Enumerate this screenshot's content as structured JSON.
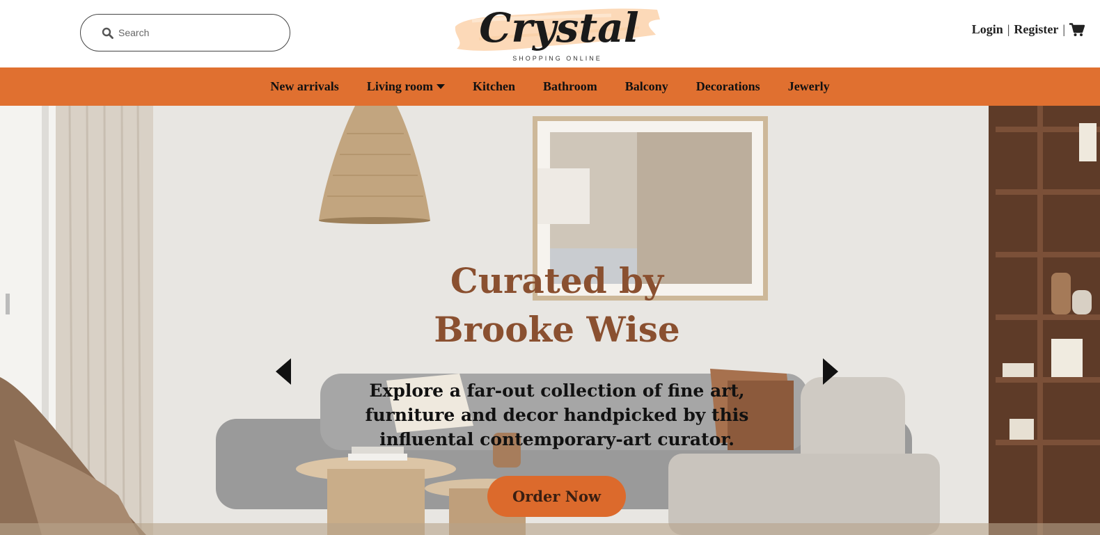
{
  "header": {
    "search": {
      "placeholder": "Search",
      "icon": "search-icon"
    },
    "logo": {
      "name": "Crystal",
      "tagline": "SHOPPING ONLINE"
    },
    "account": {
      "login": "Login",
      "separator": "|",
      "register": "Register",
      "cart_icon": "cart-icon"
    }
  },
  "nav": {
    "items": [
      {
        "label": "New arrivals"
      },
      {
        "label": "Living room",
        "has_dropdown": true
      },
      {
        "label": "Kitchen"
      },
      {
        "label": "Bathroom"
      },
      {
        "label": "Balcony"
      },
      {
        "label": "Decorations"
      },
      {
        "label": "Jewerly"
      }
    ]
  },
  "hero": {
    "title": "Curated by Brooke Wise",
    "subtitle": "Explore a far-out collection of fine art, furniture and decor handpicked by this influental contemporary-art curator.",
    "cta": "Order Now",
    "prev_icon": "caret-left-icon",
    "next_icon": "caret-right-icon"
  },
  "colors": {
    "nav_bg": "#e07030",
    "cta_bg": "#dc6a2c",
    "title": "#8a5030",
    "logo_swash": "#fcd9b8"
  }
}
